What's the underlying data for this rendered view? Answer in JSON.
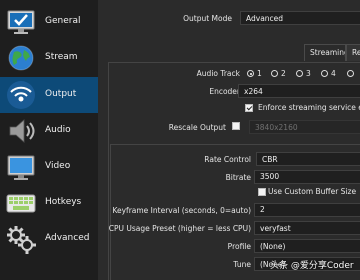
{
  "sidebar": {
    "items": [
      {
        "label": "General",
        "icon": "monitor-check-icon"
      },
      {
        "label": "Stream",
        "icon": "globe-icon"
      },
      {
        "label": "Output",
        "icon": "wifi-broadcast-icon"
      },
      {
        "label": "Audio",
        "icon": "speaker-icon"
      },
      {
        "label": "Video",
        "icon": "display-icon"
      },
      {
        "label": "Hotkeys",
        "icon": "keyboard-icon"
      },
      {
        "label": "Advanced",
        "icon": "gears-icon"
      }
    ],
    "active": "Output",
    "active_color": "#0d4a78"
  },
  "output_mode": {
    "label": "Output Mode",
    "value": "Advanced"
  },
  "tabs": [
    {
      "label": "Streaming",
      "active": true
    },
    {
      "label": "Re",
      "active": false
    }
  ],
  "streaming": {
    "audio_track": {
      "label": "Audio Track",
      "options": [
        "1",
        "2",
        "3",
        "4"
      ],
      "selected": "1"
    },
    "encoder": {
      "label": "Encoder",
      "value": "x264"
    },
    "enforce_limits": {
      "label": "Enforce streaming service enc",
      "checked": true
    },
    "rescale": {
      "label": "Rescale Output",
      "checked": false,
      "value": "3840x2160"
    },
    "rate_control": {
      "label": "Rate Control",
      "value": "CBR"
    },
    "bitrate": {
      "label": "Bitrate",
      "value": "3500"
    },
    "custom_buffer": {
      "label": "Use Custom Buffer Size",
      "checked": false
    },
    "keyframe": {
      "label": "Keyframe Interval (seconds, 0=auto)",
      "value": "2"
    },
    "cpu_preset": {
      "label": "CPU Usage Preset (higher = less CPU)",
      "value": "veryfast"
    },
    "profile": {
      "label": "Profile",
      "value": "(None)"
    },
    "tune": {
      "label": "Tune",
      "value": "(None)"
    }
  },
  "watermark": "头条 @爱分享Coder"
}
